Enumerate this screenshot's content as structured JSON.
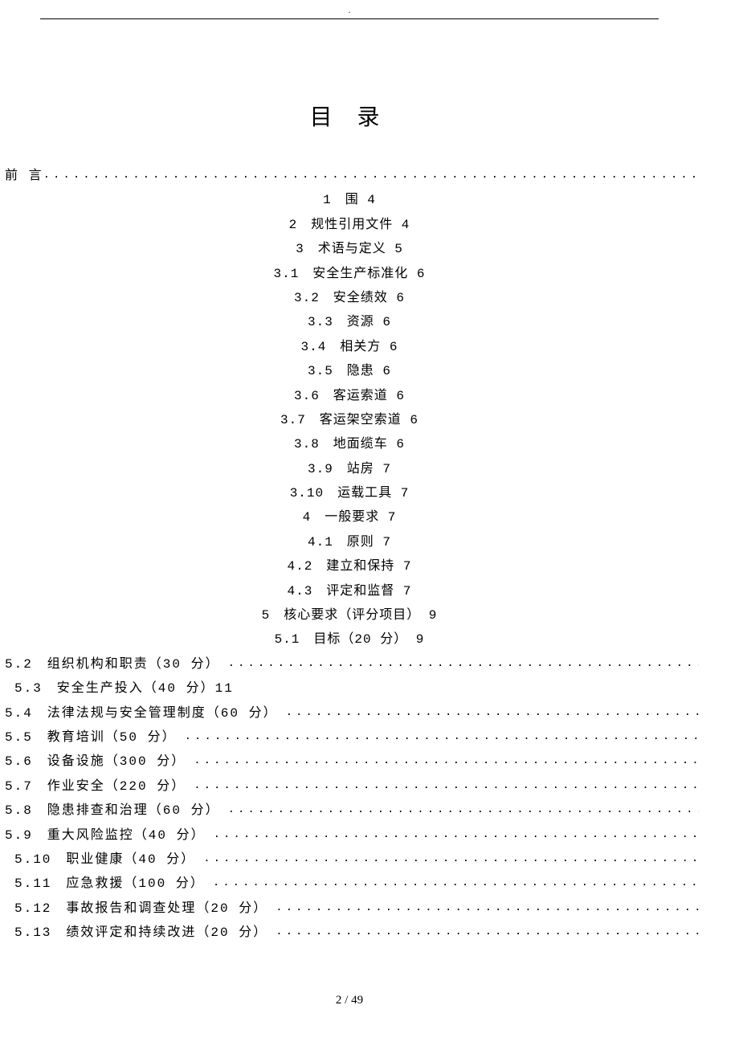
{
  "header_mark": ".",
  "title": "目 录",
  "preface": {
    "label": "前 言"
  },
  "centered": [
    {
      "num": "1",
      "text": "围",
      "page": "4"
    },
    {
      "num": "2",
      "text": "规性引用文件",
      "page": "4"
    },
    {
      "num": "3",
      "text": "术语与定义",
      "page": "5"
    },
    {
      "num": "3.1",
      "text": "安全生产标准化",
      "page": "6"
    },
    {
      "num": "3.2",
      "text": "安全绩效",
      "page": "6"
    },
    {
      "num": "3.3",
      "text": "资源",
      "page": "6"
    },
    {
      "num": "3.4",
      "text": "相关方",
      "page": "6"
    },
    {
      "num": "3.5",
      "text": "隐患",
      "page": "6"
    },
    {
      "num": "3.6",
      "text": "客运索道",
      "page": "6"
    },
    {
      "num": "3.7",
      "text": "客运架空索道",
      "page": "6"
    },
    {
      "num": "3.8",
      "text": "地面缆车",
      "page": "6"
    },
    {
      "num": "3.9",
      "text": "站房",
      "page": "7"
    },
    {
      "num": "3.10",
      "text": "运载工具",
      "page": "7"
    },
    {
      "num": "4",
      "text": "一般要求",
      "page": "7"
    },
    {
      "num": "4.1",
      "text": "原则",
      "page": "7"
    },
    {
      "num": "4.2",
      "text": "建立和保持",
      "page": "7"
    },
    {
      "num": "4.3",
      "text": "评定和监督",
      "page": "7"
    },
    {
      "num": "5",
      "text": "核心要求（评分项目）",
      "page": "9"
    },
    {
      "num": "5.1",
      "text": "目标（20 分）",
      "page": "9"
    }
  ],
  "left": [
    {
      "num": "5.2",
      "text": "组织机构和职责（30 分）",
      "dots": true,
      "indent": 1
    },
    {
      "num": "5.3",
      "text": "安全生产投入（40 分）11",
      "dots": false,
      "indent": 2
    },
    {
      "num": "5.4",
      "text": "法律法规与安全管理制度（60 分）",
      "dots": true,
      "indent": 1
    },
    {
      "num": "5.5",
      "text": "教育培训（50 分）",
      "dots": true,
      "indent": 1
    },
    {
      "num": "5.6",
      "text": "设备设施（300 分）",
      "dots": true,
      "indent": 1
    },
    {
      "num": "5.7",
      "text": "作业安全（220 分）",
      "dots": true,
      "indent": 1
    },
    {
      "num": "5.8",
      "text": "隐患排查和治理（60 分）",
      "dots": true,
      "indent": 1
    },
    {
      "num": "5.9",
      "text": "重大风险监控（40 分）",
      "dots": true,
      "indent": 1
    },
    {
      "num": "5.10",
      "text": "职业健康（40 分）",
      "dots": true,
      "indent": 2
    },
    {
      "num": "5.11",
      "text": "应急救援（100 分）",
      "dots": true,
      "indent": 2
    },
    {
      "num": "5.12",
      "text": "事故报告和调查处理（20 分）",
      "dots": true,
      "indent": 2
    },
    {
      "num": "5.13",
      "text": "绩效评定和持续改进（20 分）",
      "dots": true,
      "indent": 2
    }
  ],
  "footer": "2 / 49"
}
